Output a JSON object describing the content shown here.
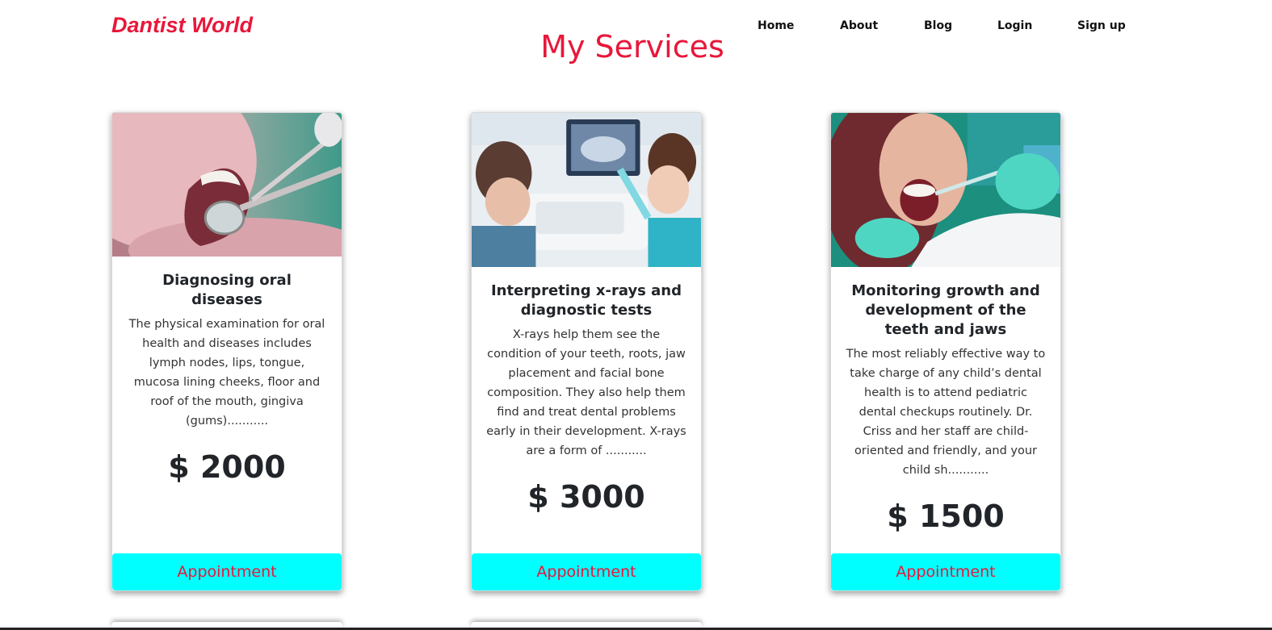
{
  "header": {
    "brand": "Dantist World",
    "nav": [
      {
        "label": "Home"
      },
      {
        "label": "About"
      },
      {
        "label": "Blog"
      },
      {
        "label": "Login"
      },
      {
        "label": "Sign up"
      }
    ]
  },
  "page_title": "My Services",
  "services": [
    {
      "title": "Diagnosing oral diseases",
      "description": "The physical examination for oral health and diseases includes lymph nodes, lips, tongue, mucosa lining cheeks, floor and roof of the mouth, gingiva (gums)...........",
      "price": "$ 2000",
      "button_label": "Appointment",
      "image_icon": "dental-mirror-photo"
    },
    {
      "title": "Interpreting x-rays and diagnostic tests",
      "description": "X-rays help them see the condition of your teeth, roots, jaw placement and facial bone composition. They also help them find and treat dental problems early in their development. X-rays are a form of ...........",
      "price": "$ 3000",
      "button_label": "Appointment",
      "image_icon": "xray-monitor-photo"
    },
    {
      "title": "Monitoring growth and development of the teeth and jaws",
      "description": "The most reliably effective way to take charge of any child’s dental health is to attend pediatric dental checkups routinely. Dr. Criss and her staff are child-oriented and friendly, and your child sh...........",
      "price": "$ 1500",
      "button_label": "Appointment",
      "image_icon": "dental-injection-photo"
    }
  ],
  "colors": {
    "accent": "#e8173a",
    "button_bg": "#00ffff"
  }
}
